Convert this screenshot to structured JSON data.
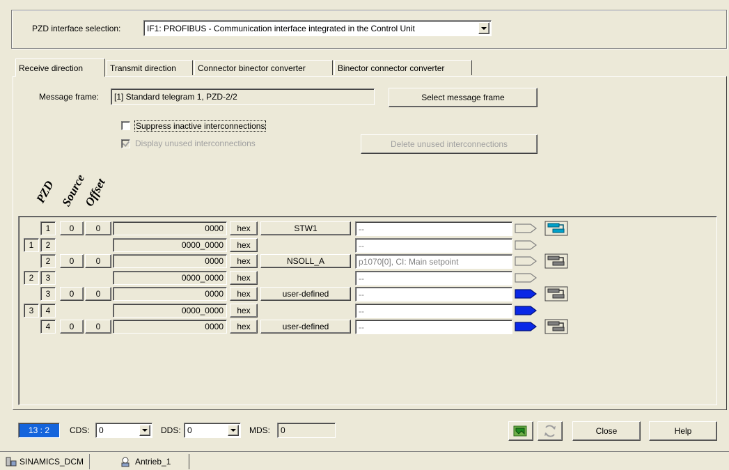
{
  "interface": {
    "label": "PZD interface selection:",
    "value": "IF1:  PROFIBUS - Communication interface integrated in the Control Unit"
  },
  "tabs": [
    {
      "label": "Receive direction"
    },
    {
      "label": "Transmit direction"
    },
    {
      "label": "Connector binector converter"
    },
    {
      "label": "Binector connector converter"
    }
  ],
  "message_frame": {
    "label": "Message frame:",
    "value": "[1] Standard telegram 1, PZD-2/2",
    "select_button": "Select message frame"
  },
  "options": {
    "suppress_label": "Suppress inactive interconnections",
    "suppress_checked": false,
    "display_label": "Display unused interconnections",
    "display_checked": true,
    "delete_button": "Delete unused interconnections"
  },
  "headers": {
    "pzd": "PZD",
    "source": "Source",
    "offset": "Offset"
  },
  "rows": [
    {
      "type": "main",
      "pzd": "1",
      "source": "0",
      "offset": "0",
      "value": "0000",
      "hex": "hex",
      "name": "STW1",
      "target": "--",
      "arrow": "grey",
      "trend": "teal"
    },
    {
      "type": "sub",
      "a": "1",
      "b": "2",
      "value": "0000_0000",
      "hex": "hex",
      "target": "--",
      "arrow": "grey"
    },
    {
      "type": "main",
      "pzd": "2",
      "source": "0",
      "offset": "0",
      "value": "0000",
      "hex": "hex",
      "name": "NSOLL_A",
      "target": "p1070[0], CI: Main setpoint",
      "arrow": "grey",
      "trend": "grey"
    },
    {
      "type": "sub",
      "a": "2",
      "b": "3",
      "value": "0000_0000",
      "hex": "hex",
      "target": "--",
      "arrow": "grey"
    },
    {
      "type": "main",
      "pzd": "3",
      "source": "0",
      "offset": "0",
      "value": "0000",
      "hex": "hex",
      "name": "user-defined",
      "target": "--",
      "arrow": "blue",
      "trend": "grey"
    },
    {
      "type": "sub",
      "a": "3",
      "b": "4",
      "value": "0000_0000",
      "hex": "hex",
      "target": "--",
      "arrow": "blue"
    },
    {
      "type": "main",
      "pzd": "4",
      "source": "0",
      "offset": "0",
      "value": "0000",
      "hex": "hex",
      "name": "user-defined",
      "target": "--",
      "arrow": "blue",
      "trend": "grey"
    }
  ],
  "status": {
    "indicator": "13 : 2",
    "cds_label": "CDS:",
    "cds_value": "0",
    "dds_label": "DDS:",
    "dds_value": "0",
    "mds_label": "MDS:",
    "mds_value": "0",
    "close_button": "Close",
    "help_button": "Help"
  },
  "taskbar": {
    "item1": "SINAMICS_DCM",
    "item2": "Antrieb_1"
  },
  "colors": {
    "face": "#ece9d8",
    "indicator_bg": "#1464dc",
    "arrow_blue": "#0a28e6",
    "trend_teal": "#00a0c8"
  }
}
